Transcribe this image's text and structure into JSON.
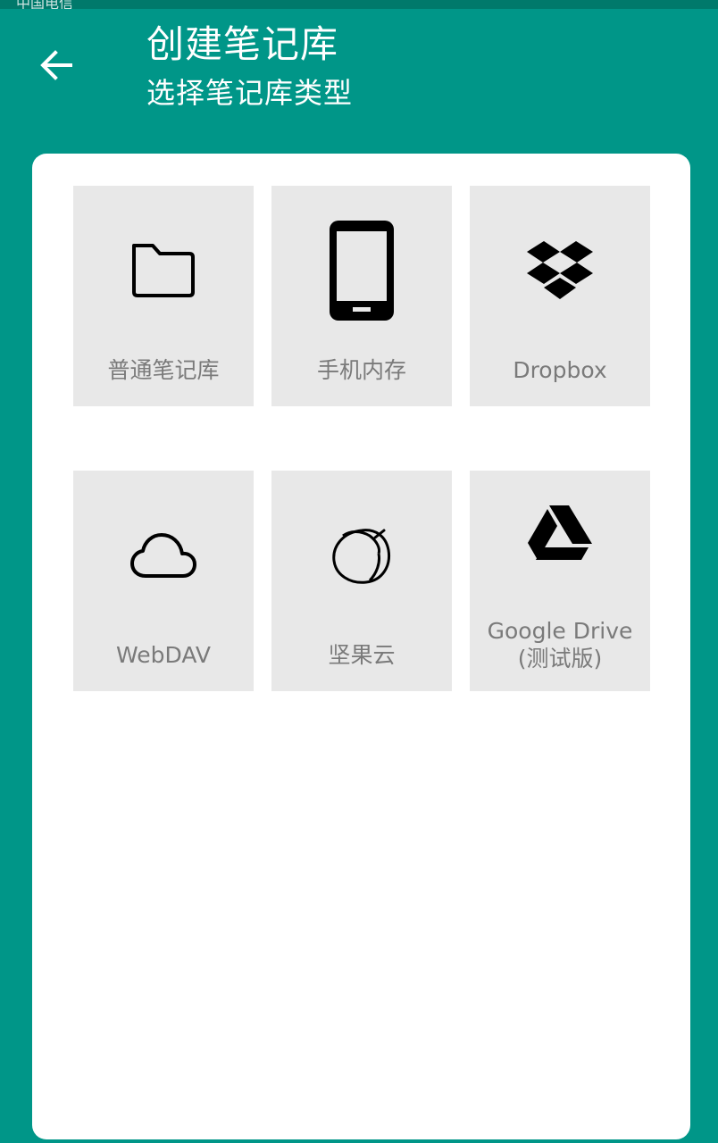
{
  "status_bar": {
    "carrier": "中国电信"
  },
  "header": {
    "back_icon": "arrow-left-icon",
    "title": "创建笔记库",
    "subtitle": "选择笔记库类型"
  },
  "colors": {
    "primary": "#009688",
    "status_bar": "#00796B",
    "tile_bg": "#E8E8E8",
    "tile_label": "#7A7A7A"
  },
  "options": [
    {
      "label": "普通笔记库",
      "icon": "folder-icon"
    },
    {
      "label": "手机内存",
      "icon": "smartphone-icon"
    },
    {
      "label": "Dropbox",
      "icon": "dropbox-icon"
    },
    {
      "label": "WebDAV",
      "icon": "cloud-icon"
    },
    {
      "label": "坚果云",
      "icon": "jianguoyun-icon"
    },
    {
      "label": "Google Drive",
      "sublabel": "(测试版)",
      "icon": "google-drive-icon"
    }
  ]
}
